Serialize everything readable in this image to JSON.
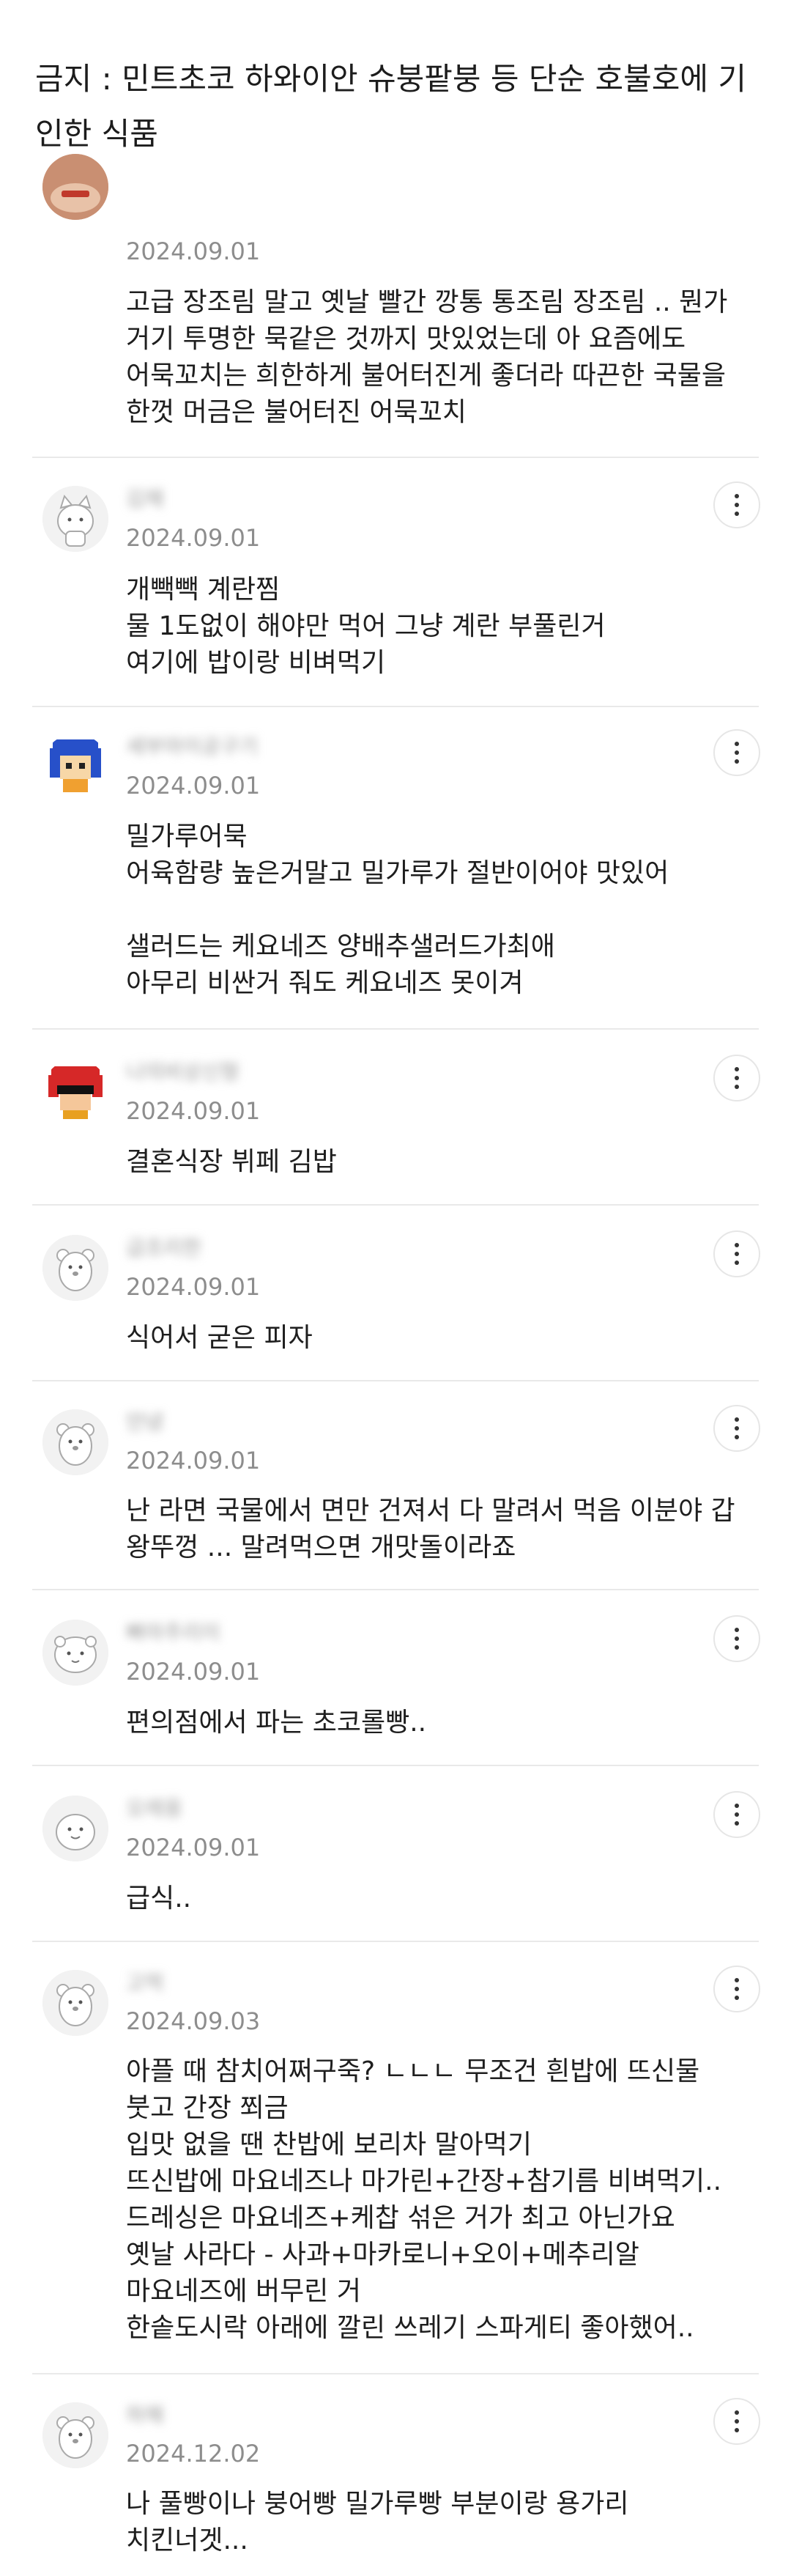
{
  "header": {
    "title": "금지 : 민트초코 하와이안 슈붕팥붕 등 단순 호불호에 기인한 식품"
  },
  "comments": [
    {
      "date": "2024.09.01",
      "text": "고급 장조림 말고 옛날 빨간 깡통 통조림 장조림 .. 뭔가 거기 투명한 묵같은 것까지 맛있었는데 아 요즘에도 어묵꼬치는 희한하게 불어터진게 좋더라 따끈한 국물을 한껏 머금은 불어터진 어묵꼬치",
      "avatar_icon": "food-photo-avatar-icon",
      "menu_icon": "more-vertical-icon"
    },
    {
      "nickname": "김채",
      "date": "2024.09.01",
      "text": "개빽빽 계란찜\n물 1도없이 해야만 먹어 그냥 계란 부풀린거\n여기에 밥이랑 비벼먹기",
      "avatar_icon": "cat-avatar-icon",
      "menu_icon": "more-vertical-icon"
    },
    {
      "nickname": "세부마이공구기",
      "date": "2024.09.01",
      "text": "밀가루어묵\n어육함량 높은거말고 밀가루가 절반이어야 맛있어\n\n샐러드는 케요네즈 양배추샐러드가최애\n아무리 비싼거 줘도 케요네즈 못이겨",
      "avatar_icon": "pixel-character-avatar-icon",
      "menu_icon": "more-vertical-icon"
    },
    {
      "nickname": "나의비상신형",
      "date": "2024.09.01",
      "text": "결혼식장 뷔페 김밥",
      "avatar_icon": "red-pixel-character-avatar-icon",
      "menu_icon": "more-vertical-icon"
    },
    {
      "nickname": "급조리한",
      "date": "2024.09.01",
      "text": "식어서 굳은 피자",
      "avatar_icon": "bear-avatar-icon",
      "menu_icon": "more-vertical-icon"
    },
    {
      "nickname": "안녕",
      "date": "2024.09.01",
      "text": "난 라면 국물에서 면만 건져서 다 말려서 먹음 이분야 갑 왕뚜껑 ... 말려먹으면 개맛돌이라죠",
      "avatar_icon": "bear-avatar-icon",
      "menu_icon": "more-vertical-icon"
    },
    {
      "nickname": "빠마주리이",
      "date": "2024.09.01",
      "text": "편의점에서 파는 초코롤빵..",
      "avatar_icon": "hamster-avatar-icon",
      "menu_icon": "more-vertical-icon"
    },
    {
      "nickname": "오레옹",
      "date": "2024.09.01",
      "text": "급식..",
      "avatar_icon": "blob-avatar-icon",
      "menu_icon": "more-vertical-icon"
    },
    {
      "nickname": "고먹",
      "date": "2024.09.03",
      "text": "아플 때 참치어쩌구죽? ㄴㄴㄴ 무조건 흰밥에 뜨신물 붓고 간장 쬐금\n입맛 없을 땐 찬밥에 보리차 말아먹기\n뜨신밥에 마요네즈나 마가린+간장+참기름 비벼먹기..\n드레싱은 마요네즈+케찹 섞은 거가 최고 아닌가요\n옛날 사라다 - 사과+마카로니+오이+메추리알 마요네즈에 버무린 거\n한솥도시락 아래에 깔린 쓰레기 스파게티 좋아했어..",
      "avatar_icon": "bear-avatar-icon",
      "menu_icon": "more-vertical-icon"
    },
    {
      "nickname": "하해",
      "date": "2024.12.02",
      "text": "나 풀빵이나 붕어빵 밀가루빵 부분이랑 용가리 치킨너겟...",
      "avatar_icon": "bear-avatar-icon",
      "menu_icon": "more-vertical-icon"
    }
  ]
}
